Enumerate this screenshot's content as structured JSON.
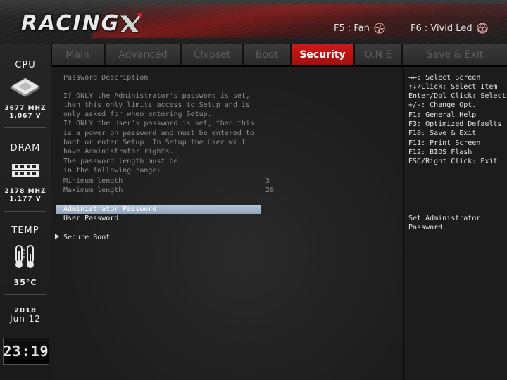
{
  "header": {
    "logo_text": "RACING",
    "f5_label": "F5 : Fan",
    "f6_label": "F6 : Vivid Led"
  },
  "tabs": [
    {
      "label": "Main",
      "active": false
    },
    {
      "label": "Advanced",
      "active": false
    },
    {
      "label": "Chipset",
      "active": false
    },
    {
      "label": "Boot",
      "active": false
    },
    {
      "label": "Security",
      "active": true
    },
    {
      "label": "O.N.E",
      "active": false
    },
    {
      "label": "Save & Exit",
      "active": false
    }
  ],
  "sidebar": {
    "cpu_title": "CPU",
    "cpu_freq": "3677 MHZ",
    "cpu_volt": "1.067 V",
    "dram_title": "DRAM",
    "dram_freq": "2178 MHZ",
    "dram_volt": "1.177 V",
    "temp_title": "TEMP",
    "temp_value": "35°C",
    "year": "2018",
    "month_day": "Jun 12",
    "time": "23:19"
  },
  "main": {
    "description_title": "Password Description",
    "description_lines": [
      "If ONLY the Administrator's password is set,",
      "then this only limits access to Setup and is",
      "only asked for when entering Setup.",
      "If ONLY the User's password is set, then this",
      "is a power on password and must be entered to",
      "boot or enter Setup. In Setup the User will",
      "have Administrator rights.",
      "The password length must be",
      "in the following range:"
    ],
    "min_label": "Minimum length",
    "min_value": "3",
    "max_label": "Maximum length",
    "max_value": "20",
    "items": [
      {
        "label": "Administrator Password",
        "selected": true
      },
      {
        "label": "User Password",
        "selected": false
      }
    ],
    "submenu": "Secure Boot"
  },
  "help": {
    "keys": [
      "→←: Select Screen",
      "↑↓/Click: Select Item",
      "Enter/Dbl Click: Select",
      "+/-: Change Opt.",
      "F1: General Help",
      "F3: Optimized Defaults",
      "F10: Save & Exit",
      "F11: Print Screen",
      "F12: BIOS Flash",
      "ESC/Right Click: Exit"
    ],
    "item_help": [
      "Set Administrator",
      "Password"
    ]
  },
  "colors": {
    "accent_red": "#c81414",
    "selection": "#a4b8cc",
    "background": "#1c1c1c"
  }
}
